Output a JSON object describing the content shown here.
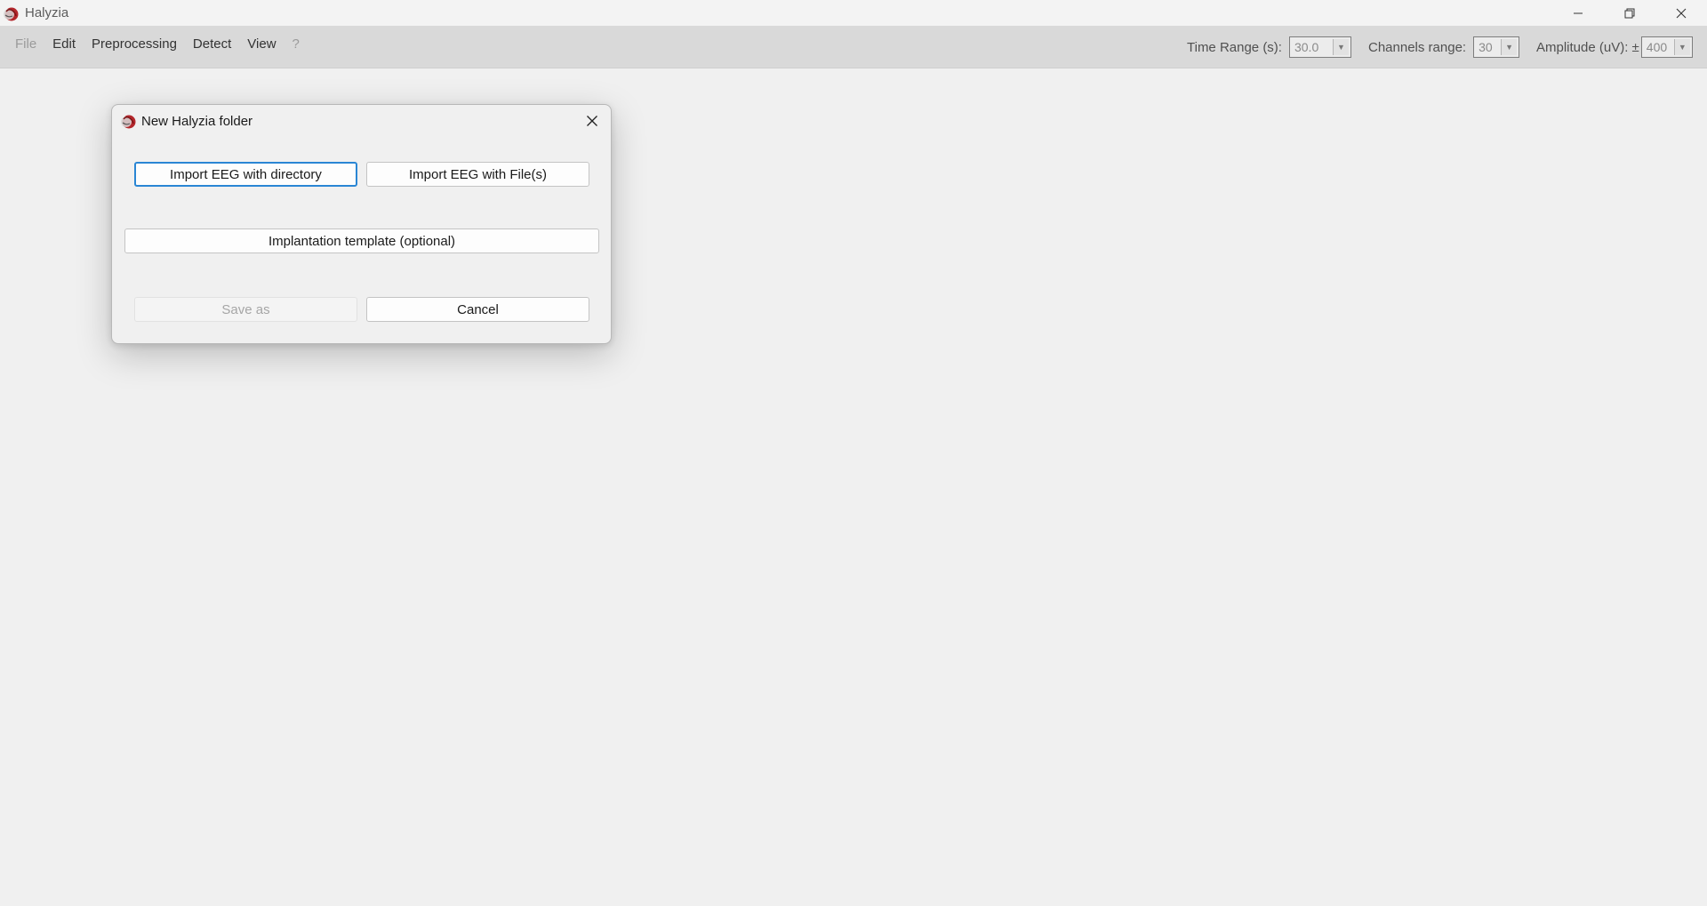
{
  "window": {
    "title": "Halyzia",
    "icon": "halyzia-logo-icon",
    "controls": [
      "minimize-icon",
      "restore-icon",
      "close-icon"
    ]
  },
  "menu": {
    "items": [
      {
        "label": "File",
        "disabled": true
      },
      {
        "label": "Edit",
        "disabled": false
      },
      {
        "label": "Preprocessing",
        "disabled": false
      },
      {
        "label": "Detect",
        "disabled": false
      },
      {
        "label": "View",
        "disabled": false
      },
      {
        "label": "?",
        "disabled": true
      }
    ]
  },
  "toolbar": {
    "time_range": {
      "label": "Time Range (s):",
      "value": "30.0"
    },
    "channels_range": {
      "label": "Channels range:",
      "value": "30"
    },
    "amplitude": {
      "label": "Amplitude (uV): ±",
      "value": "400"
    }
  },
  "dialog": {
    "title": "New Halyzia folder",
    "import_directory_label": "Import EEG with directory",
    "import_files_label": "Import EEG with File(s)",
    "implantation_label": "Implantation template (optional)",
    "save_as_label": "Save as",
    "cancel_label": "Cancel"
  },
  "colors": {
    "focus_border": "#2a86d4",
    "toolbar_bg": "#d9d9d9",
    "window_bg": "#f0f0f0"
  }
}
